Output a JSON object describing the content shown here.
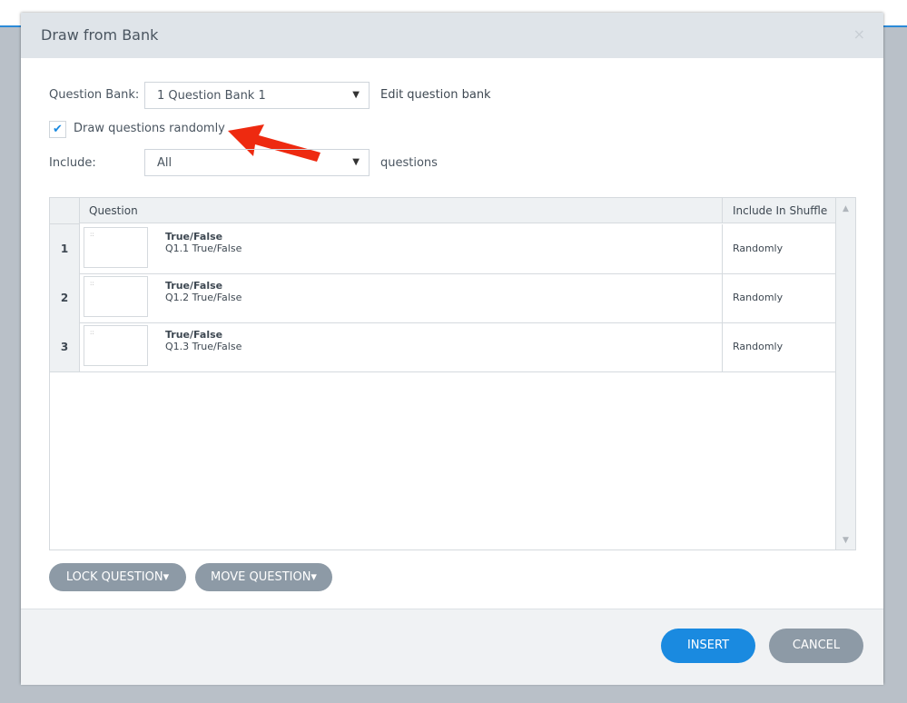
{
  "dialog": {
    "title": "Draw from Bank",
    "close": "×"
  },
  "form": {
    "bank_label": "Question Bank:",
    "bank_value": "1 Question Bank 1",
    "edit_link": "Edit question bank",
    "random_label": "Draw questions randomly",
    "random_checked": true,
    "include_label": "Include:",
    "include_value": "All",
    "include_suffix": "questions"
  },
  "grid": {
    "headers": [
      "Question",
      "Include In Shuffle"
    ],
    "rows": [
      {
        "num": "1",
        "type": "True/False",
        "name": "Q1.1 True/False",
        "shuffle": "Randomly"
      },
      {
        "num": "2",
        "type": "True/False",
        "name": "Q1.2 True/False",
        "shuffle": "Randomly"
      },
      {
        "num": "3",
        "type": "True/False",
        "name": "Q1.3 True/False",
        "shuffle": "Randomly"
      }
    ]
  },
  "actions": {
    "lock": "LOCK QUESTION▾",
    "move": "MOVE QUESTION▾",
    "insert": "INSERT",
    "cancel": "CANCEL"
  },
  "colors": {
    "accent": "#1a8ae0",
    "annotation": "#ee2a10"
  }
}
